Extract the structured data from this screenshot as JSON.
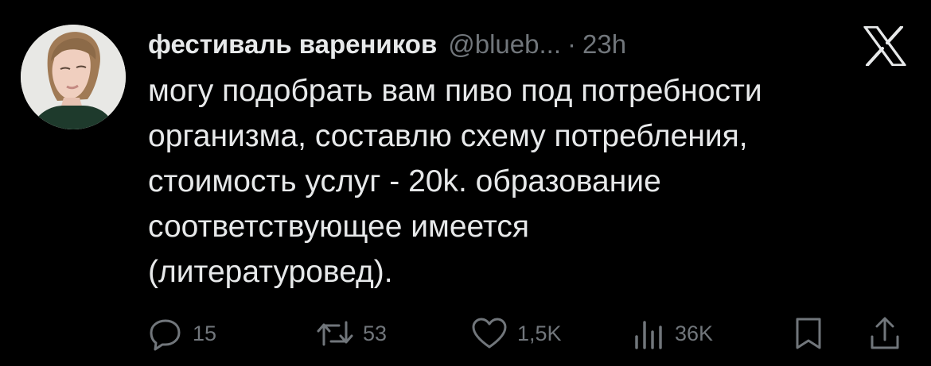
{
  "tweet": {
    "author": {
      "display_name": "фестиваль вареников",
      "handle": "@blueb...",
      "separator": "·",
      "time": "23h"
    },
    "text_lines": [
      "могу подобрать вам пиво под потребности",
      "организма, составлю схему потребления,",
      "стоимость услуг - 20k. образование",
      "соответствующее имеется",
      "(литературовед)."
    ],
    "actions": {
      "replies": "15",
      "reposts": "53",
      "likes": "1,5K",
      "views": "36K"
    },
    "icons": {
      "platform": "x-logo-icon",
      "reply": "reply-icon",
      "repost": "repost-icon",
      "like": "heart-icon",
      "views": "views-icon",
      "bookmark": "bookmark-icon",
      "share": "share-icon"
    }
  },
  "colors": {
    "background": "#000000",
    "primary_text": "#e7e9ea",
    "secondary_text": "#71767b"
  }
}
